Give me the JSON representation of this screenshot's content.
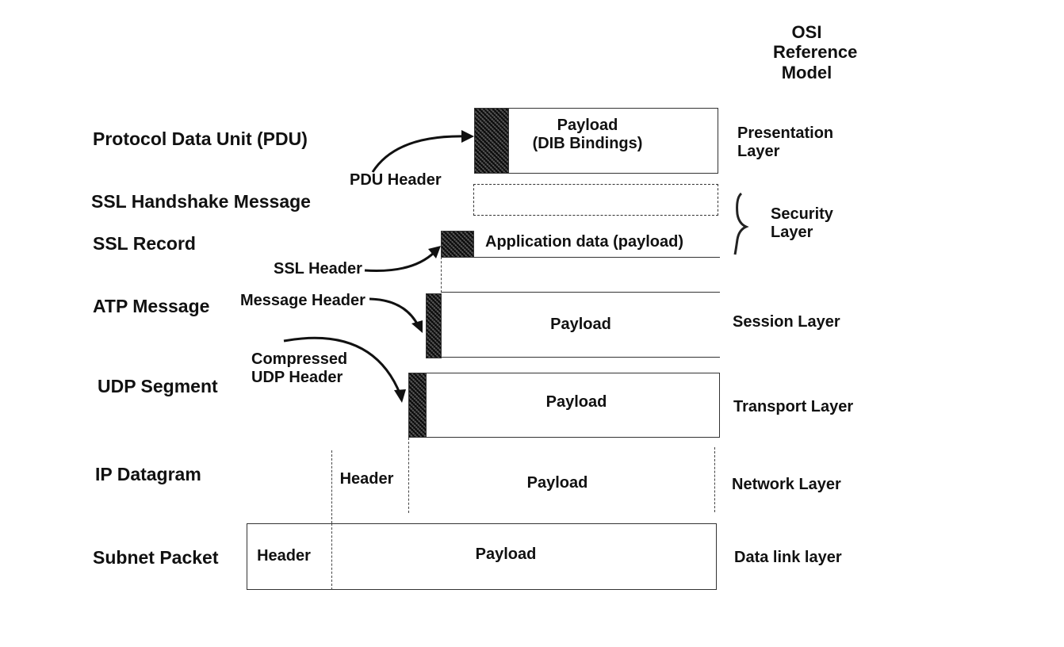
{
  "osi_title": [
    "OSI",
    "Reference",
    "Model"
  ],
  "rows": [
    {
      "name": "Protocol Data Unit (PDU)",
      "osi_layer": "Presentation Layer",
      "payload": "Payload",
      "payload_sub": "(DIB Bindings)",
      "header": "PDU Header"
    },
    {
      "name": "SSL Handshake Message"
    },
    {
      "name": "SSL Record",
      "payload": "Application data (payload)",
      "header": "SSL Header"
    },
    {
      "name": "ATP Message",
      "osi_layer": "Session Layer",
      "payload": "Payload",
      "header": "Message Header"
    },
    {
      "name": "UDP Segment",
      "osi_layer": "Transport Layer",
      "payload": "Payload",
      "header_line1": "Compressed",
      "header_line2": "UDP Header"
    },
    {
      "name": "IP Datagram",
      "osi_layer": "Network Layer",
      "payload": "Payload",
      "header": "Header"
    },
    {
      "name": "Subnet Packet",
      "osi_layer": "Data link layer",
      "payload": "Payload",
      "header": "Header"
    }
  ],
  "security_layer": [
    "Security",
    "Layer"
  ],
  "presentation_layer": [
    "Presentation",
    "Layer"
  ]
}
